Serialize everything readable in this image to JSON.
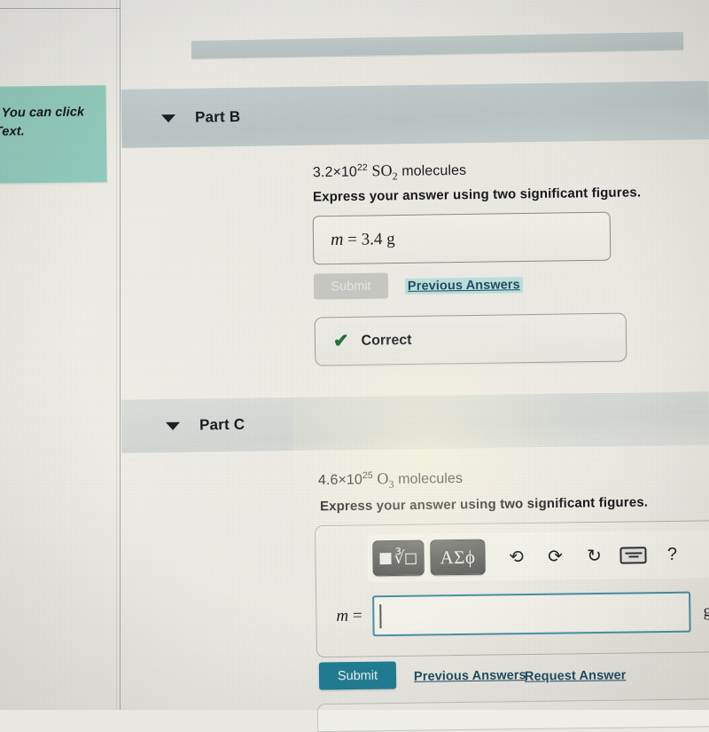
{
  "sidebar": {
    "hint_text": ". You can click Text."
  },
  "main": {
    "part_b": {
      "toggle_icon": "caret-down-icon",
      "title": "Part B",
      "question_prefix": "3.2×10",
      "question_exponent": "22",
      "question_formula_main": "SO",
      "question_formula_sub": "2",
      "question_suffix": " molecules",
      "instruction": "Express your answer using two significant figures.",
      "answer_variable": "m",
      "answer_equals": "=",
      "answer_value": "3.4",
      "answer_unit": "g",
      "submit_label": "Submit",
      "previous_answers_label": "Previous Answers",
      "feedback_icon": "check-icon",
      "feedback_text": "Correct"
    },
    "part_c": {
      "toggle_icon": "caret-down-icon",
      "title": "Part C",
      "question_prefix": "4.6×10",
      "question_exponent": "25",
      "question_formula_main": "O",
      "question_formula_sub": "3",
      "question_suffix": " molecules",
      "instruction": "Express your answer using two significant figures.",
      "toolbar": {
        "template_button_label": "√",
        "greek_button_label": "ΑΣϕ",
        "undo_icon": "undo-arrow-icon",
        "redo_icon": "redo-arrow-icon",
        "reset_icon": "refresh-icon",
        "keyboard_icon": "keyboard-icon",
        "help_label": "?"
      },
      "answer_variable": "m",
      "answer_equals": "=",
      "answer_value": "",
      "answer_unit": "g",
      "submit_label": "Submit",
      "previous_answers_label": "Previous Answers",
      "request_answer_label": "Request Answer"
    }
  },
  "colors": {
    "hint_background": "#93cec0",
    "part_b_header": "#bdc7c8",
    "part_c_header": "#d6d9d6",
    "submit_active": "#207f96",
    "submit_disabled": "#c9c9c6",
    "link": "#1f4e64",
    "correct_check": "#1f6b33",
    "input_focus_border": "#4a93a6"
  }
}
